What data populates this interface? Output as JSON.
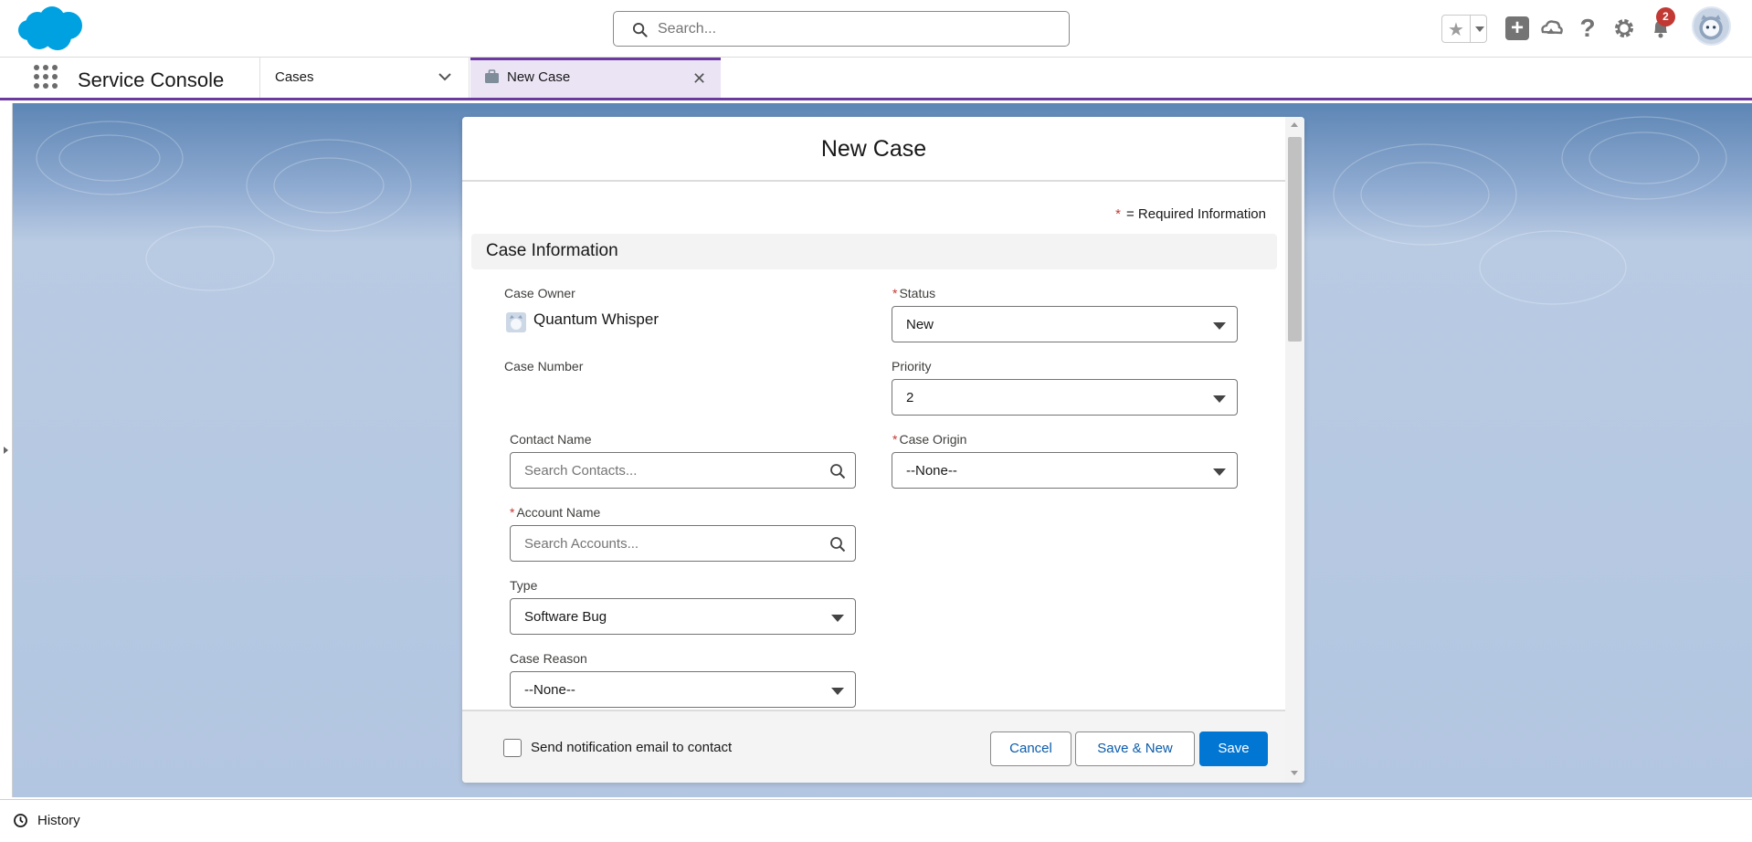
{
  "header": {
    "search_placeholder": "Search...",
    "notification_count": "2",
    "brand_color": "#00a1e0"
  },
  "nav": {
    "app_name": "Service Console",
    "tabs": [
      {
        "label": "Cases"
      },
      {
        "label": "New Case",
        "active": true
      }
    ],
    "accent_color": "#6c3a9e"
  },
  "modal": {
    "title": "New Case",
    "required_info": "= Required Information",
    "required_star": "*",
    "section_title": "Case Information",
    "fields": {
      "case_owner_label": "Case Owner",
      "case_owner_value": "Quantum Whisper",
      "case_number_label": "Case Number",
      "contact_name_label": "Contact Name",
      "contact_name_placeholder": "Search Contacts...",
      "account_name_label": "Account Name",
      "account_name_placeholder": "Search Accounts...",
      "type_label": "Type",
      "type_value": "Software Bug",
      "case_reason_label": "Case Reason",
      "case_reason_value": "--None--",
      "status_label": "Status",
      "status_value": "New",
      "priority_label": "Priority",
      "priority_value": "2",
      "case_origin_label": "Case Origin",
      "case_origin_value": "--None--"
    },
    "footer": {
      "notify_label": "Send notification email to contact",
      "cancel": "Cancel",
      "save_new": "Save & New",
      "save": "Save"
    }
  },
  "utility_bar": {
    "history_label": "History"
  }
}
